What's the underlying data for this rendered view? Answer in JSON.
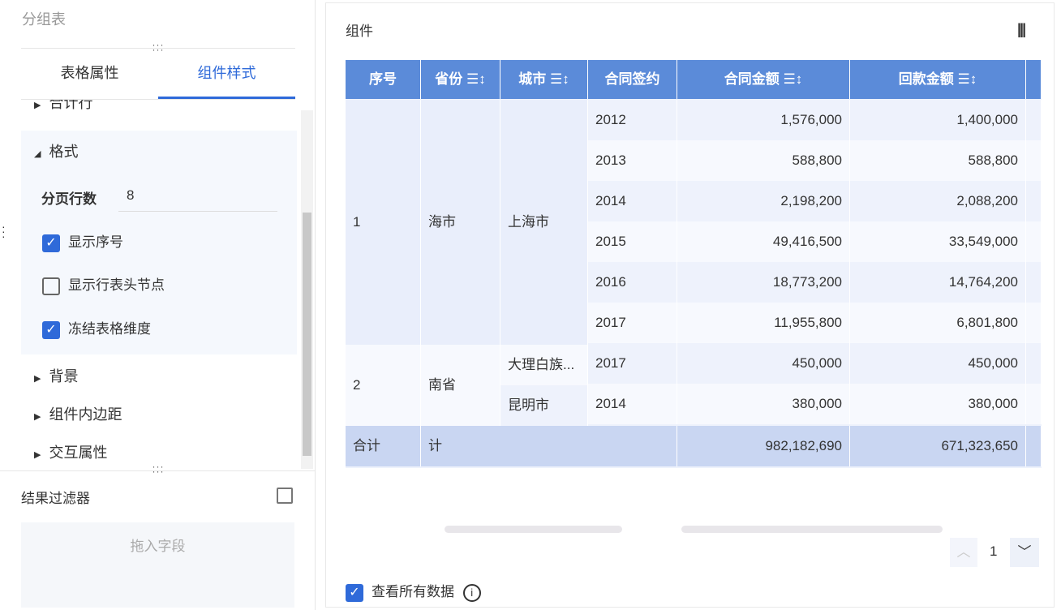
{
  "left": {
    "title": "分组表",
    "tabs": [
      "表格属性",
      "组件样式"
    ],
    "active_tab": 1,
    "sections": {
      "total_row": "合计行",
      "format": "格式",
      "background": "背景",
      "padding": "组件内边距",
      "interaction": "交互属性"
    },
    "page_rows_label": "分页行数",
    "page_rows_value": "8",
    "checkboxes": [
      {
        "label": "显示序号",
        "checked": true
      },
      {
        "label": "显示行表头节点",
        "checked": false
      },
      {
        "label": "冻结表格维度",
        "checked": true
      }
    ],
    "filter_title": "结果过滤器",
    "filter_placeholder": "拖入字段"
  },
  "right": {
    "title": "组件",
    "columns": [
      "序号",
      "省份",
      "城市",
      "合同签约",
      "合同金额",
      "回款金额"
    ],
    "groups": [
      {
        "idx": "1",
        "province": "海市",
        "city": "上海市"
      },
      {
        "idx": "2",
        "province": "南省",
        "cities": [
          "大理白族...",
          "昆明市"
        ]
      }
    ],
    "rows": [
      [
        "2012",
        "1,576,000",
        "1,400,000"
      ],
      [
        "2013",
        "588,800",
        "588,800"
      ],
      [
        "2014",
        "2,198,200",
        "2,088,200"
      ],
      [
        "2015",
        "49,416,500",
        "33,549,000"
      ],
      [
        "2016",
        "18,773,200",
        "14,764,200"
      ],
      [
        "2017",
        "11,955,800",
        "6,801,800"
      ],
      [
        "2017",
        "450,000",
        "450,000"
      ],
      [
        "2014",
        "380,000",
        "380,000"
      ]
    ],
    "total": {
      "label": "合计",
      "label2": "计",
      "amount": "982,182,690",
      "returned": "671,323,650"
    },
    "page": "1",
    "view_all": "查看所有数据",
    "accent": "#5b8bd9"
  }
}
